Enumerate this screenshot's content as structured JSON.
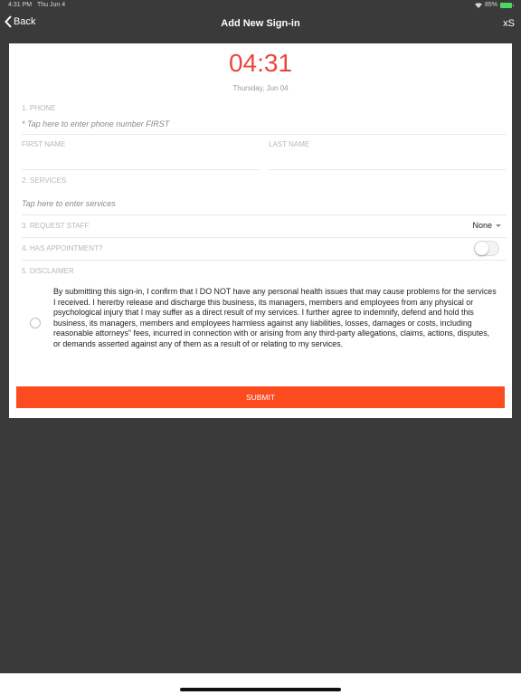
{
  "status": {
    "time": "4:31 PM",
    "date": "Thu Jun 4",
    "battery": "85%"
  },
  "nav": {
    "back_label": "Back",
    "title": "Add New Sign-in",
    "right_label": "xS"
  },
  "clock": {
    "time": "04:31",
    "date": "Thursday, Jun 04"
  },
  "form": {
    "phone_label": "1. PHONE",
    "phone_placeholder": "* Tap here to enter phone number FIRST",
    "first_name_label": "FIRST NAME",
    "last_name_label": "LAST NAME",
    "services_label": "2. SERVICES",
    "services_placeholder": "Tap here to enter services",
    "staff_label": "3. REQUEST STAFF",
    "staff_value": "None",
    "appointment_label": "4. HAS APPOINTMENT?",
    "disclaimer_label": "5. DISCLAIMER",
    "disclaimer_text": "By submitting this sign-in, I confirm that I DO NOT have any personal health issues that may cause problems for the services I received. I hererby release and discharge this business, its managers, members and employees from any physical or psychological injury that I may suffer as a direct result of my services. I further agree to indemnify, defend and hold this business, its managers, members and employees harmless against any liabilities, losses, damages or costs, including reasonable attorneys\" fees, incurred in connection with or arising from any third-party allegations, claims, actions, disputes, or demands asserted against any of them as a result of or relating to my services.",
    "submit_label": "SUBMIT"
  },
  "colors": {
    "accent": "#fb4b1f",
    "clock": "#e8483f",
    "background": "#3a3a3a"
  }
}
